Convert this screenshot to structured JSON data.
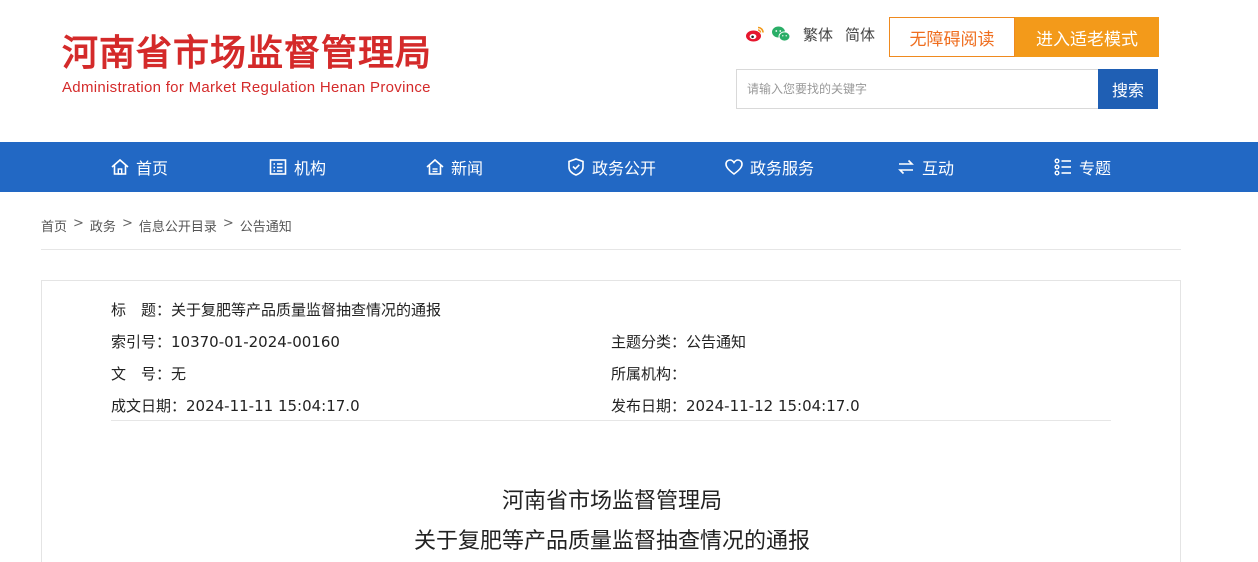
{
  "header": {
    "title_cn": "河南省市场监督管理局",
    "title_en": "Administration for Market Regulation Henan Province",
    "icons": [
      "weibo-icon",
      "wechat-icon"
    ],
    "traditional": "繁体",
    "simplified": "简体",
    "accessible_btn": "无障碍阅读",
    "elder_btn": "进入适老模式",
    "search_placeholder": "请输入您要找的关键字",
    "search_btn": "搜索"
  },
  "nav": {
    "items": [
      {
        "label": "首页",
        "icon": "home-icon"
      },
      {
        "label": "机构",
        "icon": "org-icon"
      },
      {
        "label": "新闻",
        "icon": "news-icon"
      },
      {
        "label": "政务公开",
        "icon": "shield-icon"
      },
      {
        "label": "政务服务",
        "icon": "heart-icon"
      },
      {
        "label": "互动",
        "icon": "exchange-icon"
      },
      {
        "label": "专题",
        "icon": "topic-icon"
      }
    ]
  },
  "breadcrumb": [
    "首页",
    "政务",
    "信息公开目录",
    "公告通知"
  ],
  "meta": {
    "title": "标　题：关于复肥等产品质量监督抽查情况的通报",
    "index_no": "索引号：10370-01-2024-00160",
    "category": "主题分类：公告通知",
    "doc_no": "文　号：无",
    "agency": "所属机构：",
    "created": "成文日期：2024-11-11 15:04:17.0",
    "published": "发布日期：2024-11-12 15:04:17.0"
  },
  "document": {
    "heading1": "河南省市场监督管理局",
    "heading2": "关于复肥等产品质量监督抽查情况的通报"
  },
  "colors": {
    "brand_red": "#d42a2a",
    "nav_blue": "#2268c4",
    "search_blue": "#1f5fb4",
    "accent_orange": "#f39a1a"
  }
}
